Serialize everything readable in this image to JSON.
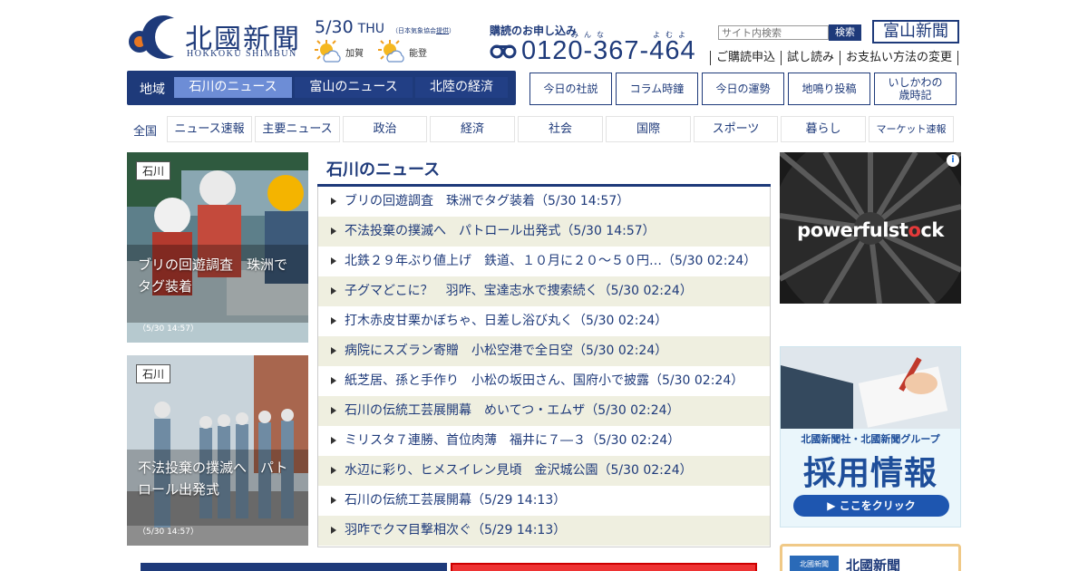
{
  "header": {
    "logo_name": "北國新聞",
    "logo_sub": "HOKKOKU SHIMBUN",
    "date": "5/30",
    "weekday": "THU",
    "weather_source_prefix": "（日本気象協会",
    "weather_source_link": "提供",
    "weather_source_suffix": "）",
    "weather": [
      {
        "area": "加賀",
        "icon": "sun-cloud-icon"
      },
      {
        "area": "能登",
        "icon": "sun-cloud-icon"
      }
    ],
    "subscribe_label": "購読のお申し込み",
    "ruby_1": "みんな",
    "ruby_2": "よむよ",
    "phone": "0120-367-464",
    "search_placeholder": "サイト内検索",
    "search_button": "検索",
    "toyama_button": "富山新聞",
    "top_links": [
      "ご購読申込",
      "試し読み",
      "お支払い方法の変更"
    ]
  },
  "region": {
    "label": "地域",
    "tabs": [
      "石川のニュース",
      "富山のニュース",
      "北陸の経済"
    ],
    "active_index": 0
  },
  "quick_links": [
    "今日の社説",
    "コラム時鐘",
    "今日の運勢",
    "地鳴り投稿",
    "いしかわの",
    "歳時記"
  ],
  "categories": {
    "all_label": "全国",
    "items": [
      "ニュース速報",
      "主要ニュース",
      "政治",
      "経済",
      "社会",
      "国際",
      "スポーツ",
      "暮らし",
      "マーケット速報"
    ]
  },
  "photos": [
    {
      "tag": "石川",
      "caption": "ブリの回遊調査　珠洲でタグ装着",
      "time": "（5/30 14:57）"
    },
    {
      "tag": "石川",
      "caption": "不法投棄の撲滅へ　パトロール出発式",
      "time": "（5/30 14:57）"
    }
  ],
  "news": {
    "title": "石川のニュース",
    "items": [
      "ブリの回遊調査　珠洲でタグ装着（5/30 14:57）",
      "不法投棄の撲滅へ　パトロール出発式（5/30 14:57）",
      "北鉄２９年ぶり値上げ　鉄道、１０月に２０～５０円…（5/30 02:24）",
      "子グマどこに？　羽咋、宝達志水で捜索続く（5/30 02:24）",
      "打木赤皮甘栗かぼちゃ、日差し浴び丸く（5/30 02:24）",
      "病院にスズラン寄贈　小松空港で全日空（5/30 02:24）",
      "紙芝居、孫と手作り　小松の坂田さん、国府小で披露（5/30 02:24）",
      "石川の伝統工芸展開幕　めいてつ・エムザ（5/30 02:24）",
      "ミリスタ７連勝、首位肉薄　福井に７―３（5/30 02:24）",
      "水辺に彩り、ヒメスイレン見頃　金沢城公園（5/30 02:24）",
      "石川の伝統工芸展開幕（5/29 14:13）",
      "羽咋でクマ目撃相次ぐ（5/29 14:13）"
    ]
  },
  "ads": {
    "info_mark": "i",
    "powerful_a": "powerful",
    "powerful_b": "st",
    "powerful_c": "ck",
    "recruit_company": "北國新聞社・北國新聞グループ",
    "recruit_title": "採用情報",
    "recruit_click": "▶ ここをクリック",
    "bottom_logo": "北國新聞",
    "bottom_title": "北國新聞"
  },
  "colors": {
    "brand": "#1e3a7a",
    "active_tab": "#6d8dd6",
    "alt_row": "#efefe0"
  }
}
